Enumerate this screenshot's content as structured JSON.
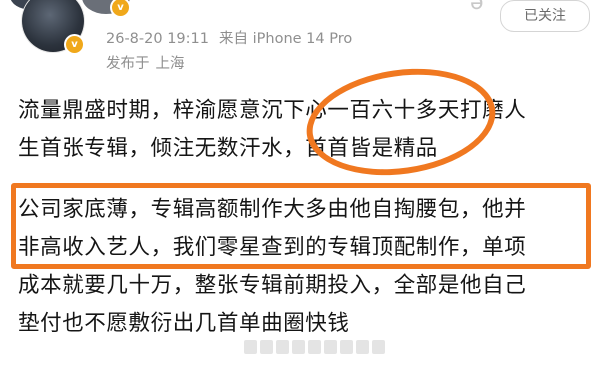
{
  "header": {
    "badge_letter": "v",
    "follow_label": "已关注"
  },
  "post": {
    "timestamp": "26-8-20 19:11",
    "source": "来自 iPhone 14 Pro",
    "location_label": "发布于",
    "location_city": "上海",
    "paragraph1_lines": [
      "流量鼎盛时期，梓渝愿意沉下心一百六十多天打磨人",
      "生首张专辑，倾注无数汗水，首首皆是精品"
    ],
    "paragraph2_lines": [
      "公司家底薄，专辑高额制作大多由他自掏腰包，他并",
      "非高收入艺人，我们零星查到的专辑顶配制作，单项",
      "成本就要几十万，整张专辑前期投入，全部是他自己",
      "垫付也不愿敷衍出几首单曲圈快钱"
    ]
  },
  "annotations": {
    "color": "#f07820"
  }
}
